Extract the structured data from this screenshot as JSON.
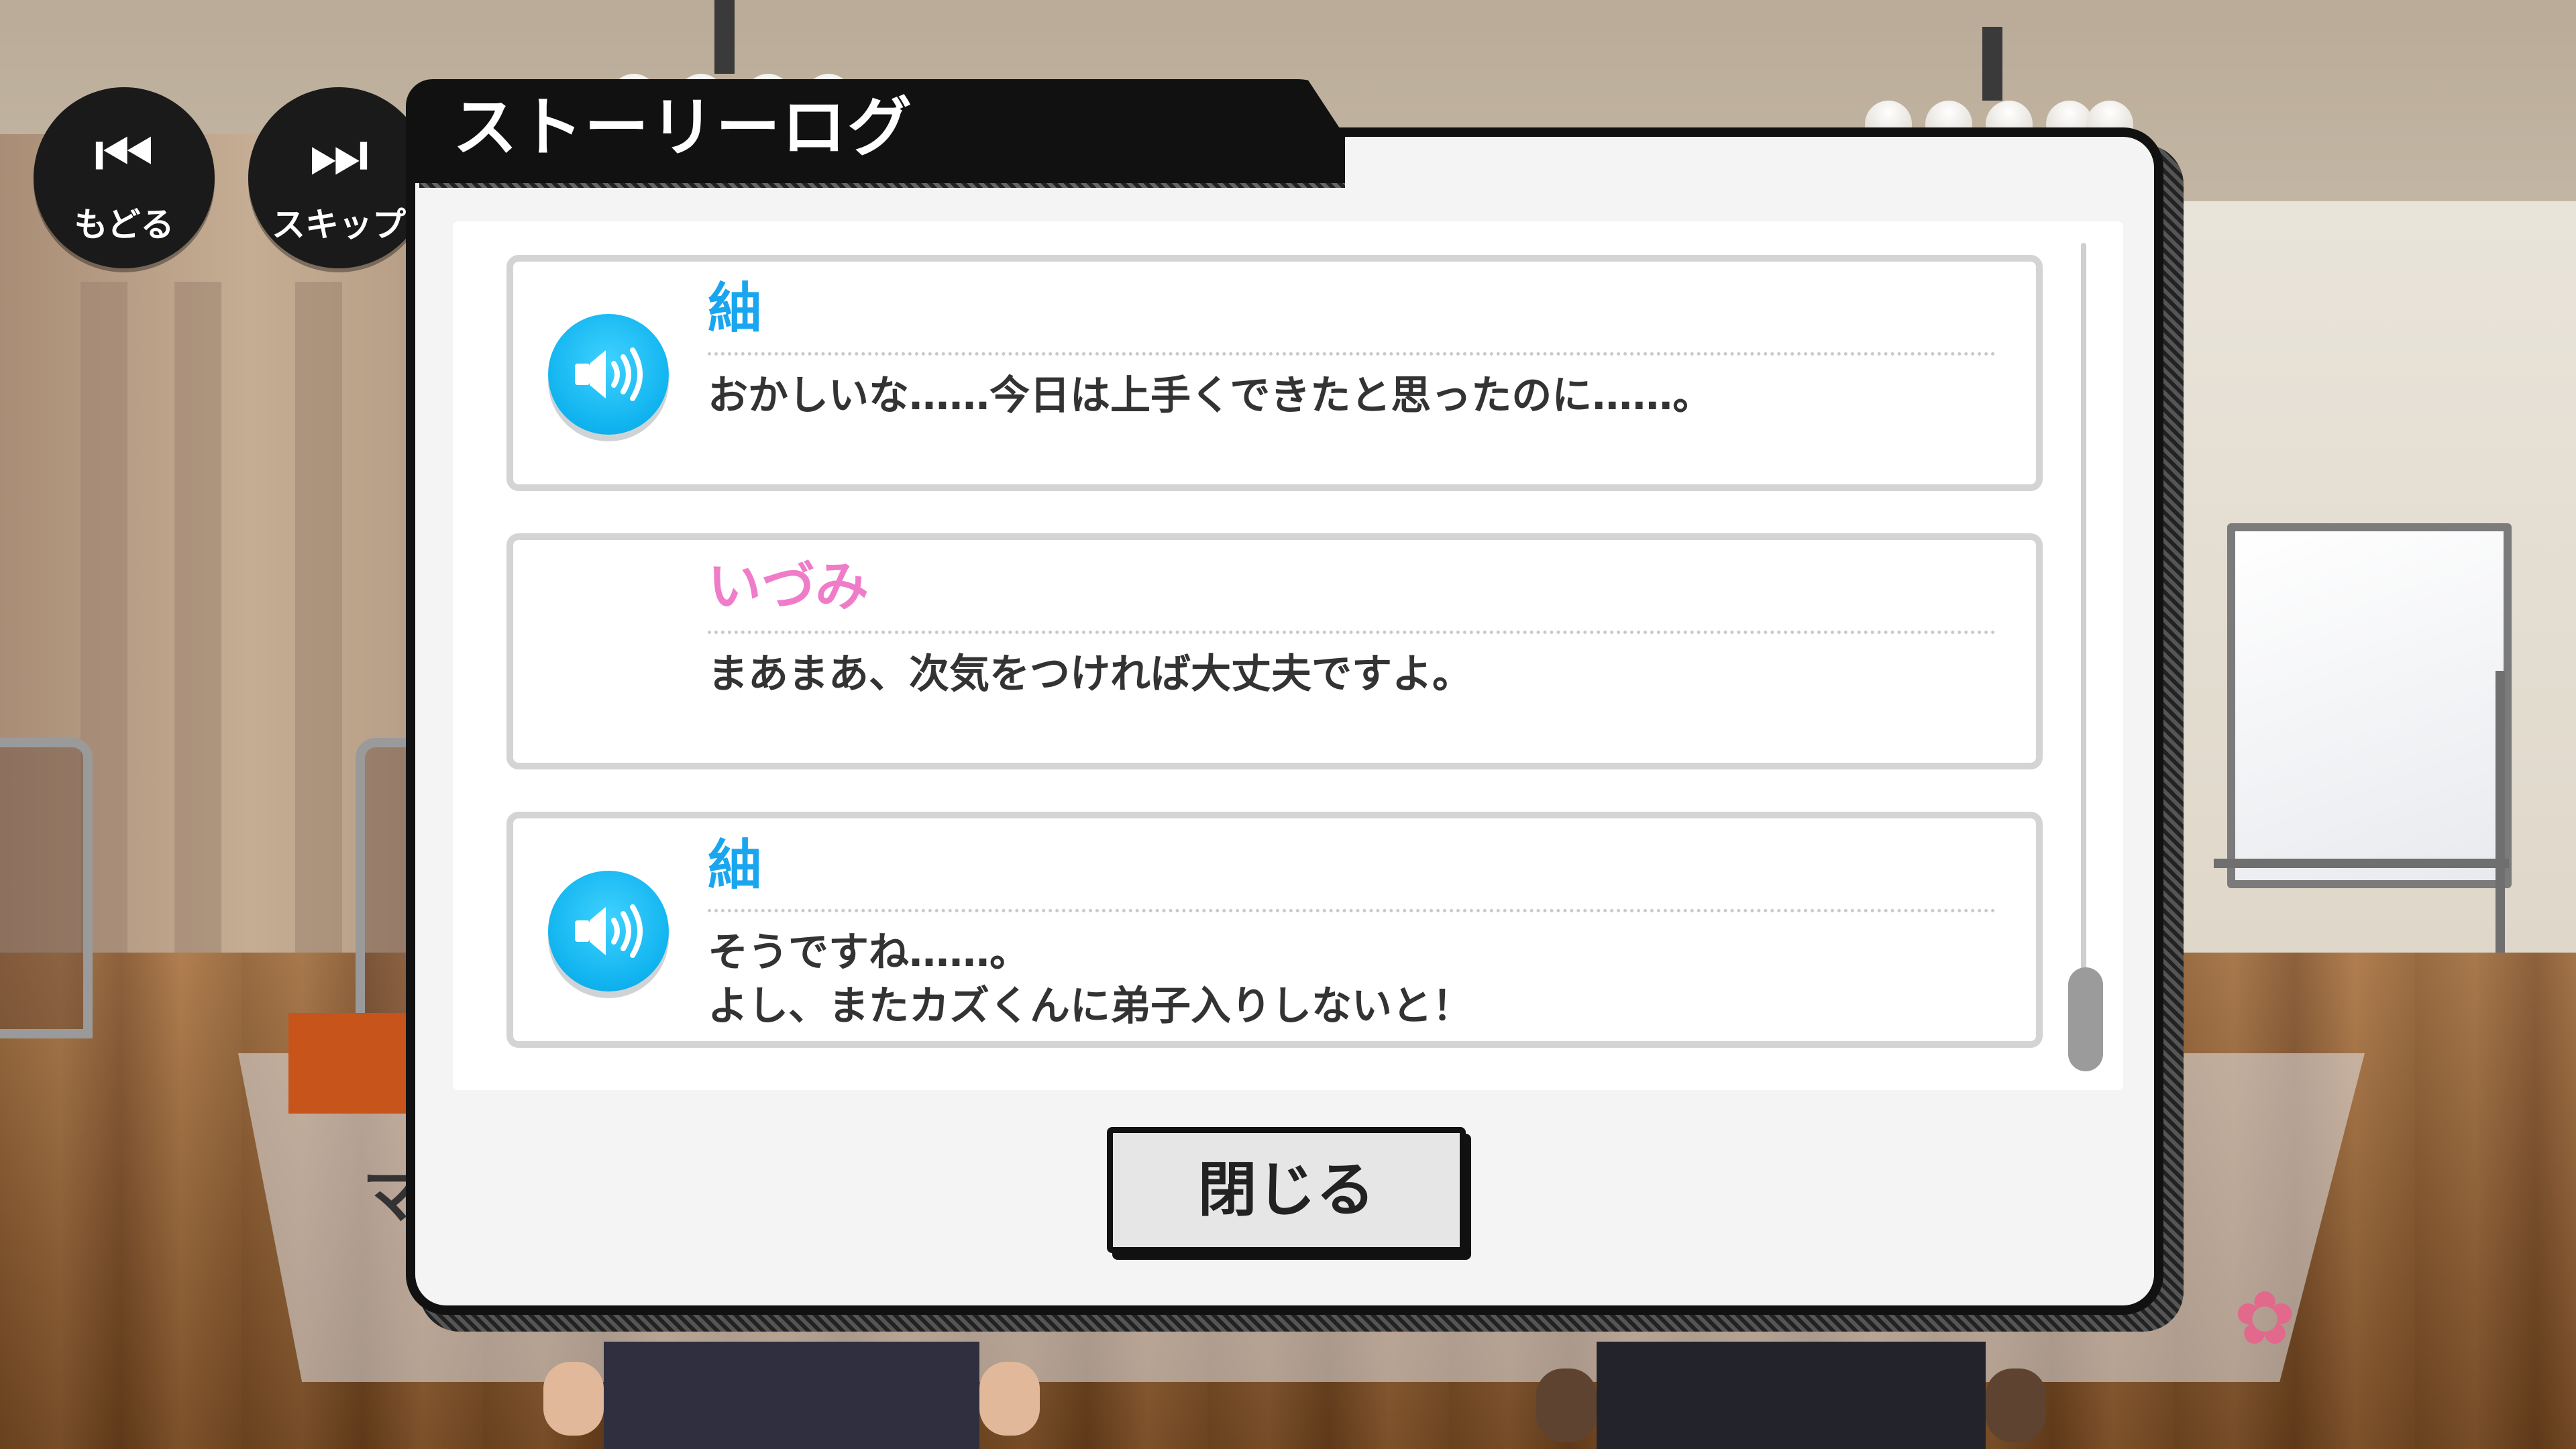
{
  "controls": {
    "back": {
      "label": "もどる",
      "icon": "step-back-icon"
    },
    "skip": {
      "label": "スキップ",
      "icon": "step-forward-icon"
    }
  },
  "panel": {
    "title": "ストーリーログ",
    "close_label": "閉じる"
  },
  "colors": {
    "speaker_blue": "#10b3ef",
    "name_blue": "#1aa6ef",
    "name_pink": "#f07cc9"
  },
  "log": [
    {
      "speaker": "紬",
      "name_color": "#1aa6ef",
      "has_voice": true,
      "lines": [
        "おかしいな……今日は上手くできたと思ったのに……。"
      ]
    },
    {
      "speaker": "いづみ",
      "name_color": "#f07cc9",
      "has_voice": false,
      "lines": [
        "まあまあ、次気をつければ大丈夫ですよ。"
      ]
    },
    {
      "speaker": "紬",
      "name_color": "#1aa6ef",
      "has_voice": true,
      "lines": [
        "そうですね……。",
        "よし、またカズくんに弟子入りしないと！"
      ]
    }
  ],
  "background": {
    "partial_text": "マ"
  }
}
